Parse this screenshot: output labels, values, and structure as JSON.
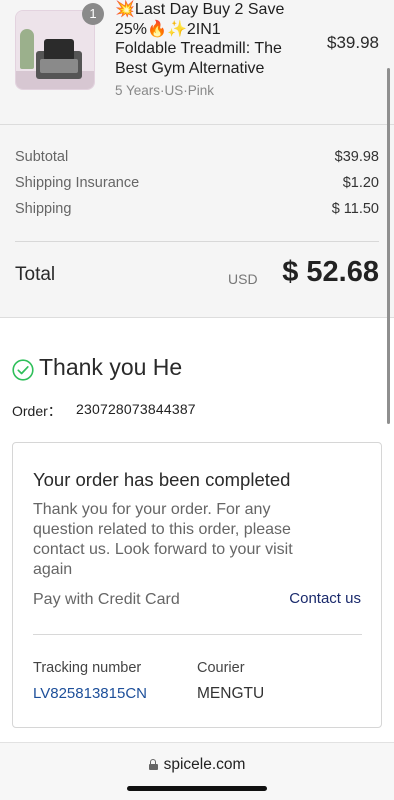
{
  "product": {
    "quantity": "1",
    "title_lines": [
      "💥Last Day Buy 2 Save",
      "25%🔥✨2IN1",
      "Foldable Treadmill: The",
      "Best Gym Alternative"
    ],
    "variant": "5 Years·US·Pink",
    "price": "$39.98"
  },
  "summary": {
    "subtotal_label": "Subtotal",
    "subtotal_value": "$39.98",
    "insurance_label": "Shipping Insurance",
    "insurance_value": "$1.20",
    "shipping_label": "Shipping",
    "shipping_value": "$ 11.50",
    "total_label": "Total",
    "currency": "USD",
    "total_value": "$ 52.68"
  },
  "confirmation": {
    "thanks_text": "Thank you He",
    "order_label": "Order：",
    "order_number": "230728073844387"
  },
  "card": {
    "title": "Your order has been completed",
    "body_lines": [
      "Thank you for your order. For any",
      "question related to this order, please",
      "contact us. Look forward to your visit",
      "again"
    ],
    "pay_method": "Pay with Credit Card",
    "contact_link": "Contact us",
    "tracking_label": "Tracking number",
    "tracking_value": "LV825813815CN",
    "courier_label": "Courier",
    "courier_value": "MENGTU"
  },
  "browser": {
    "domain": "spicele.com"
  },
  "colors": {
    "check_green": "#2fbf5a",
    "link_navy": "#1a2a6c",
    "tracking_blue": "#1d4f9a",
    "summary_bg": "#f5f5f5"
  },
  "icons": {
    "check": "check-circle-icon",
    "lock": "lock-icon"
  }
}
